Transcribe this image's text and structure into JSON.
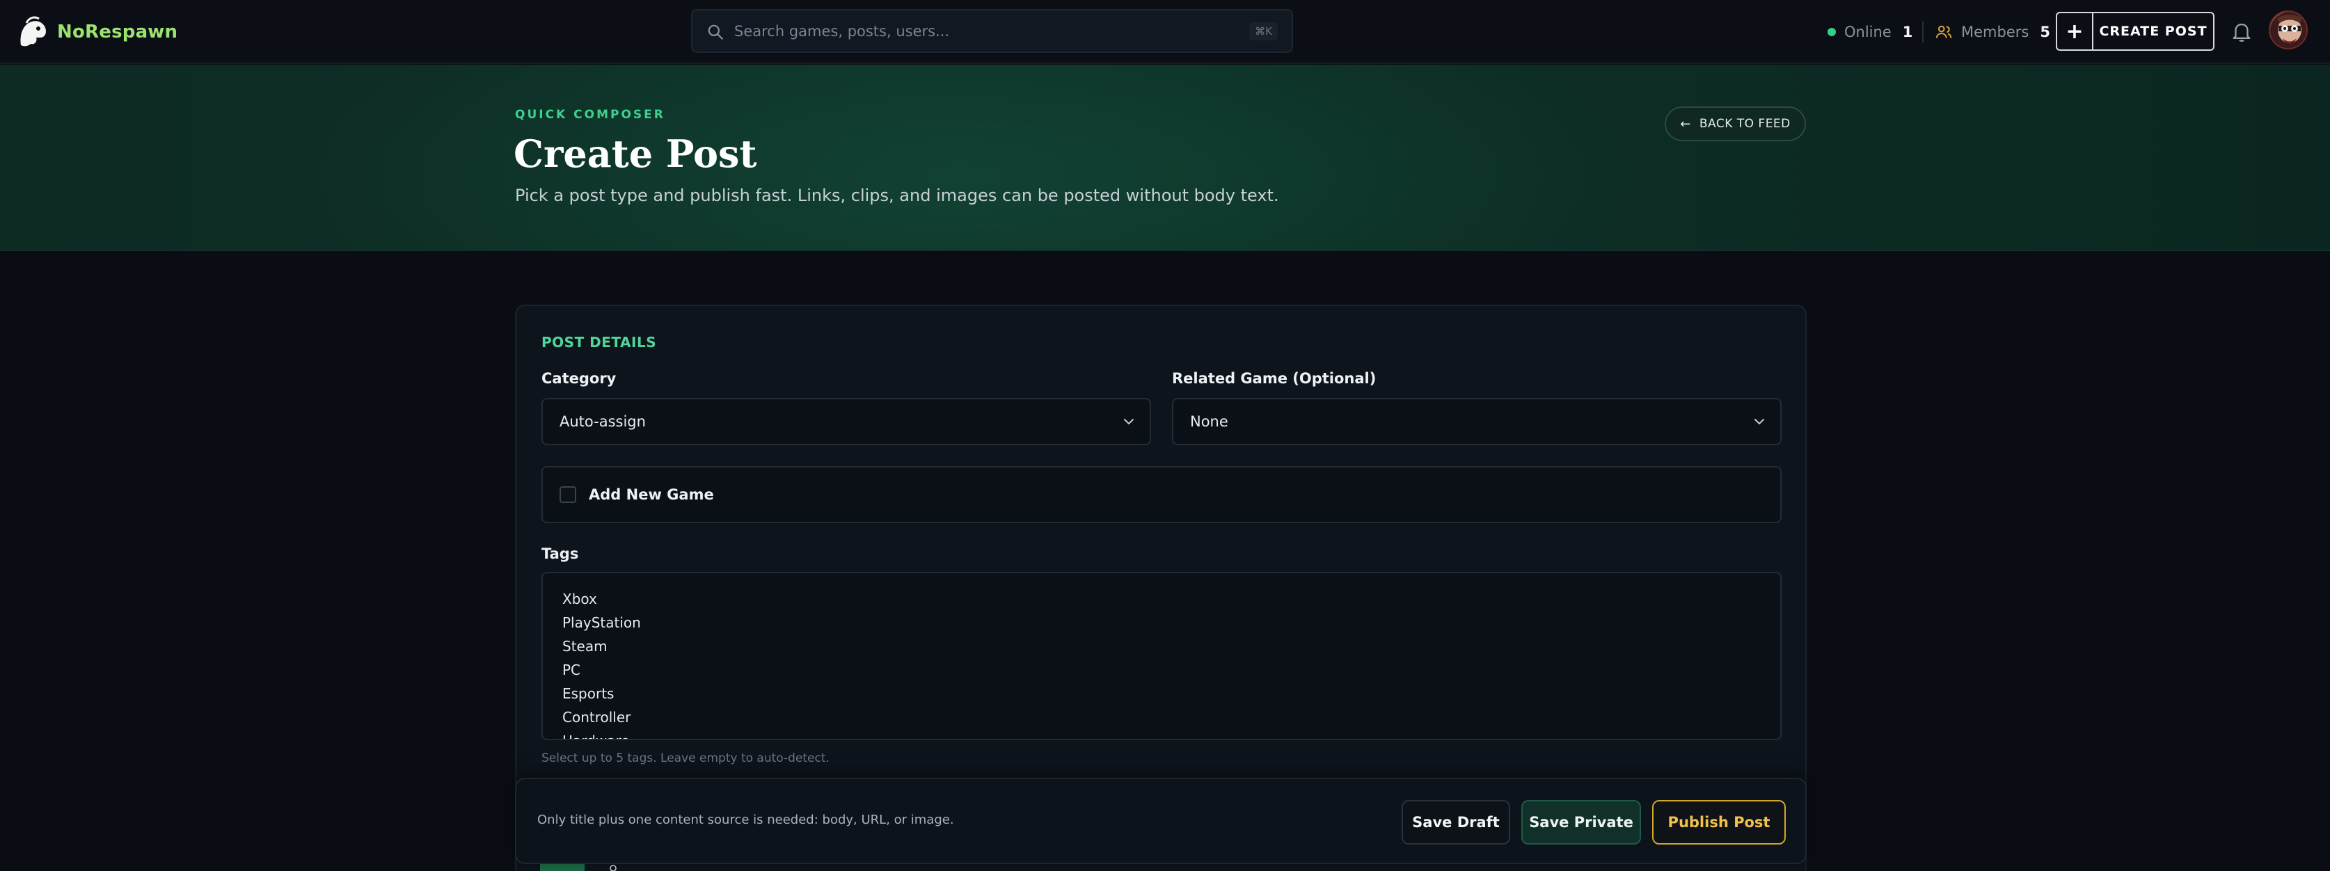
{
  "brand": {
    "name": "NoRespawn"
  },
  "search": {
    "placeholder": "Search games, posts, users...",
    "shortcut": "⌘K"
  },
  "stats": {
    "online_label": "Online",
    "online_count": "1",
    "members_label": "Members",
    "members_count": "5"
  },
  "header": {
    "create_post_label": "CREATE POST"
  },
  "hero": {
    "eyebrow": "QUICK COMPOSER",
    "title": "Create Post",
    "subtitle": "Pick a post type and publish fast. Links, clips, and images can be posted without body text.",
    "back_label": "BACK TO FEED",
    "back_arrow": "←"
  },
  "form": {
    "section_title": "POST DETAILS",
    "category_label": "Category",
    "category_value": "Auto-assign",
    "game_label": "Related Game (Optional)",
    "game_value": "None",
    "add_game_label": "Add New Game",
    "tags_label": "Tags",
    "tags_options": [
      "Xbox",
      "PlayStation",
      "Steam",
      "PC",
      "Esports",
      "Controller",
      "Hardware"
    ],
    "tags_help": "Select up to 5 tags. Leave empty to auto-detect."
  },
  "actions": {
    "note": "Only title plus one content source is needed: body, URL, or image.",
    "save_draft": "Save Draft",
    "save_private": "Save Private",
    "publish": "Publish Post"
  },
  "colors": {
    "accent_green": "#4fd69b",
    "brand_green": "#9be26e",
    "publish_gold": "#d4a526",
    "online_dot": "#2fd08a"
  }
}
